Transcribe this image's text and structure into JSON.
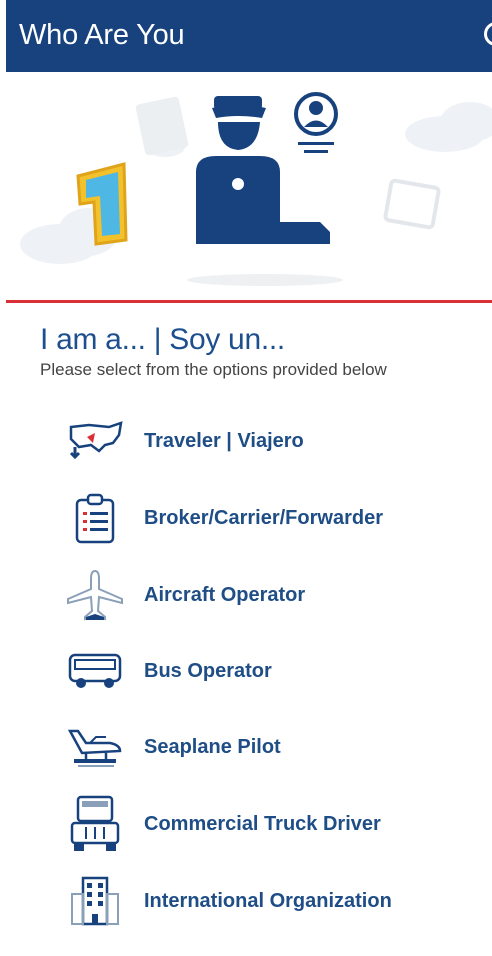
{
  "appbar": {
    "title": "Who Are You"
  },
  "hero": {
    "badge_number": "1"
  },
  "heading": "I am a... | Soy un...",
  "subtitle": "Please select from the options provided below",
  "options": [
    {
      "label": "Traveler | Viajero",
      "icon": "us-map-icon"
    },
    {
      "label": "Broker/Carrier/Forwarder",
      "icon": "clipboard-icon"
    },
    {
      "label": "Aircraft Operator",
      "icon": "airplane-icon"
    },
    {
      "label": "Bus Operator",
      "icon": "bus-icon"
    },
    {
      "label": "Seaplane Pilot",
      "icon": "seaplane-icon"
    },
    {
      "label": "Commercial Truck Driver",
      "icon": "truck-icon"
    },
    {
      "label": "International Organization",
      "icon": "building-icon"
    }
  ],
  "colors": {
    "primary": "#17427e",
    "accent": "#d83036",
    "text": "#1f4d86"
  }
}
